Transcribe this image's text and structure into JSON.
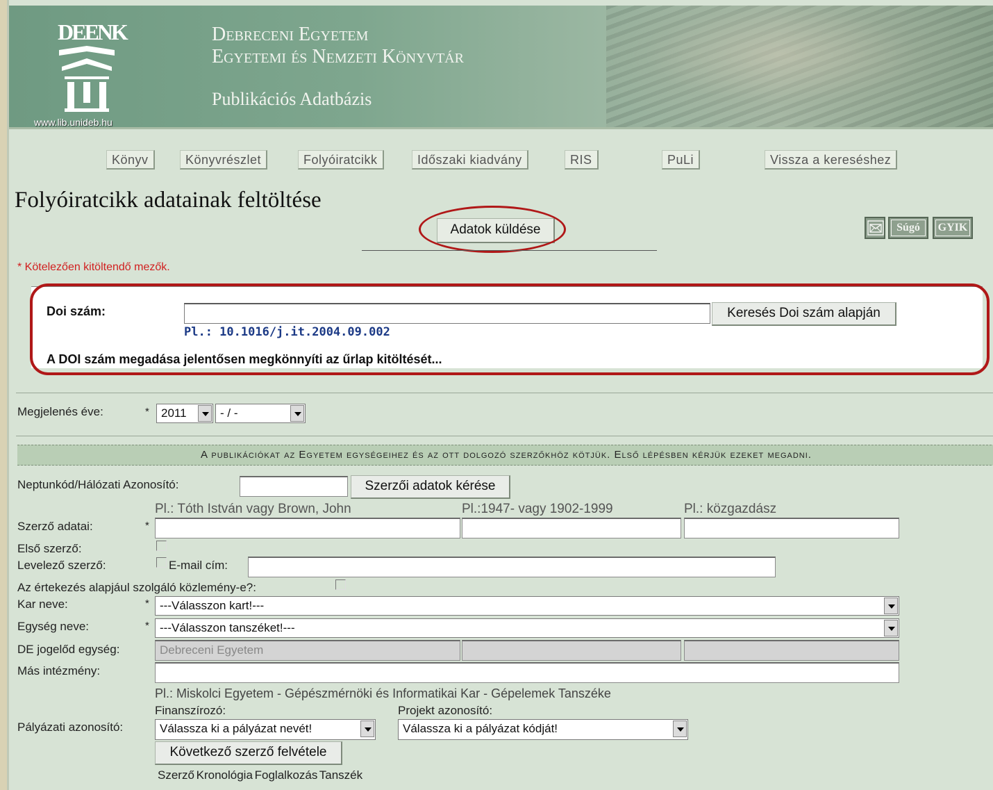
{
  "banner": {
    "logo_letters": "DEENK",
    "logo_url": "www.lib.unideb.hu",
    "title_line1": "Debreceni Egyetem",
    "title_line2": "Egyetemi és Nemzeti Könyvtár",
    "subtitle": "Publikációs Adatbázis"
  },
  "nav": {
    "items": [
      "Könyv",
      "Könyvrészlet",
      "Folyóiratcikk",
      "Időszaki kiadvány",
      "RIS",
      "PuLi",
      "Vissza a kereséshez"
    ]
  },
  "page": {
    "title": "Folyóiratcikk adatainak feltöltése",
    "send_button": "Adatok küldése",
    "help_button": "Súgó",
    "faq_button": "GYIK",
    "mail_icon": "mail-icon",
    "required_note": "* Kötelezően kitöltendő mezők."
  },
  "doi": {
    "label": "Doi szám:",
    "value": "",
    "search_button": "Keresés Doi szám alapján",
    "example": "Pl.: 10.1016/j.it.2004.09.002",
    "hint": "A DOI szám megadása jelentősen megkönnyíti az űrlap kitöltését..."
  },
  "year": {
    "label": "Megjelenés éve:",
    "star": "*",
    "year_value": "2011",
    "month_value": "- / -"
  },
  "info_bar": "A publikációkat az Egyetem egységeihez és az ott dolgozó szerzőkhöz kötjük. Első lépésben kérjük ezeket megadni.",
  "author": {
    "neptun_label": "Neptunkód/Hálózati Azonosító:",
    "neptun_value": "",
    "request_button": "Szerzői adatok kérése",
    "name_hint": "Pl.: Tóth István vagy Brown, John",
    "dates_hint": "Pl.:1947- vagy 1902-1999",
    "occupation_hint": "Pl.: közgazdász",
    "data_label": "Szerző adatai:",
    "star": "*",
    "first_author_label": "Első szerző:",
    "corresponding_label": "Levelező szerző:",
    "email_label": "E-mail cím:",
    "email_value": "",
    "dissertation_label": "Az értekezés alapjául szolgáló közlemény-e?:",
    "faculty_label": "Kar neve:",
    "faculty_value": "---Válasszon kart!---",
    "unit_label": "Egység neve:",
    "unit_value": "---Válasszon tanszéket!---",
    "legal_label": "DE jogelőd egység:",
    "legal_value": "Debreceni Egyetem",
    "other_label": "Más intézmény:",
    "other_value": "",
    "other_hint": "Pl.: Miskolci Egyetem - Gépészmérnöki és Informatikai Kar - Gépelemek Tanszéke",
    "funder_label": "Finanszírozó:",
    "project_label": "Projekt azonosító:",
    "grant_label": "Pályázati azonosító:",
    "funder_value": "Válassza ki a pályázat nevét!",
    "project_value": "Válassza ki a pályázat kódját!",
    "next_author_button": "Következő szerző felvétele",
    "bottom_labels": "Szerző Kronológia Foglalkozás Tanszék"
  },
  "colors": {
    "page_bg": "#d7e3d5",
    "highlight_red": "#b01818",
    "required_red": "#d12020",
    "doi_blue": "#1c3a86",
    "info_bar_bg": "#b9ceb5"
  }
}
